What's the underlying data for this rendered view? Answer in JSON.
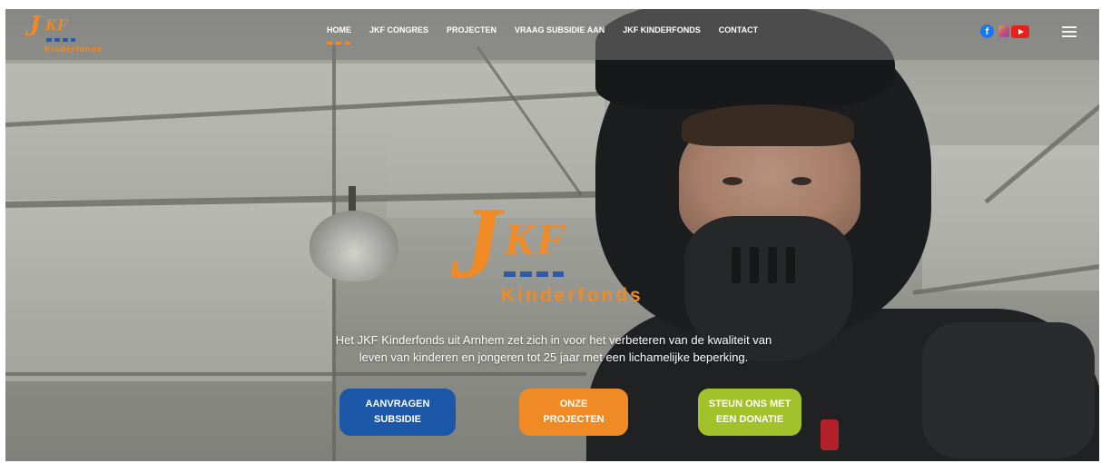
{
  "brand": {
    "logo_letter": "J",
    "logo_kf": "KF",
    "logo_sub": "Kinderfonds",
    "orange": "#f08a24",
    "blue": "#1d57a7",
    "green": "#a3c12a"
  },
  "nav": {
    "items": [
      {
        "label": "HOME",
        "active": true
      },
      {
        "label": "JKF CONGRES"
      },
      {
        "label": "PROJECTEN"
      },
      {
        "label": "VRAAG SUBSIDIE AAN"
      },
      {
        "label": "JKF KINDERFONDS"
      },
      {
        "label": "CONTACT"
      }
    ],
    "social_icons": [
      "facebook-icon",
      "instagram-icon",
      "youtube-icon"
    ],
    "menu_icon": "hamburger-icon"
  },
  "hero": {
    "logo_letter": "J",
    "logo_kf": "KF",
    "logo_sub": "Kinderfonds",
    "tagline_line1": "Het JKF Kinderfonds uit Arnhem zet zich in voor het verbeteren van de kwaliteit van",
    "tagline_line2": "leven van kinderen en jongeren tot 25 jaar met een lichamelijke beperking.",
    "buttons": [
      {
        "line1": "AANVRAGEN",
        "line2": "SUBSIDIE"
      },
      {
        "line1": "ONZE",
        "line2": "PROJECTEN"
      },
      {
        "line1": "STEUN ONS MET",
        "line2": "EEN DONATIE"
      }
    ]
  }
}
